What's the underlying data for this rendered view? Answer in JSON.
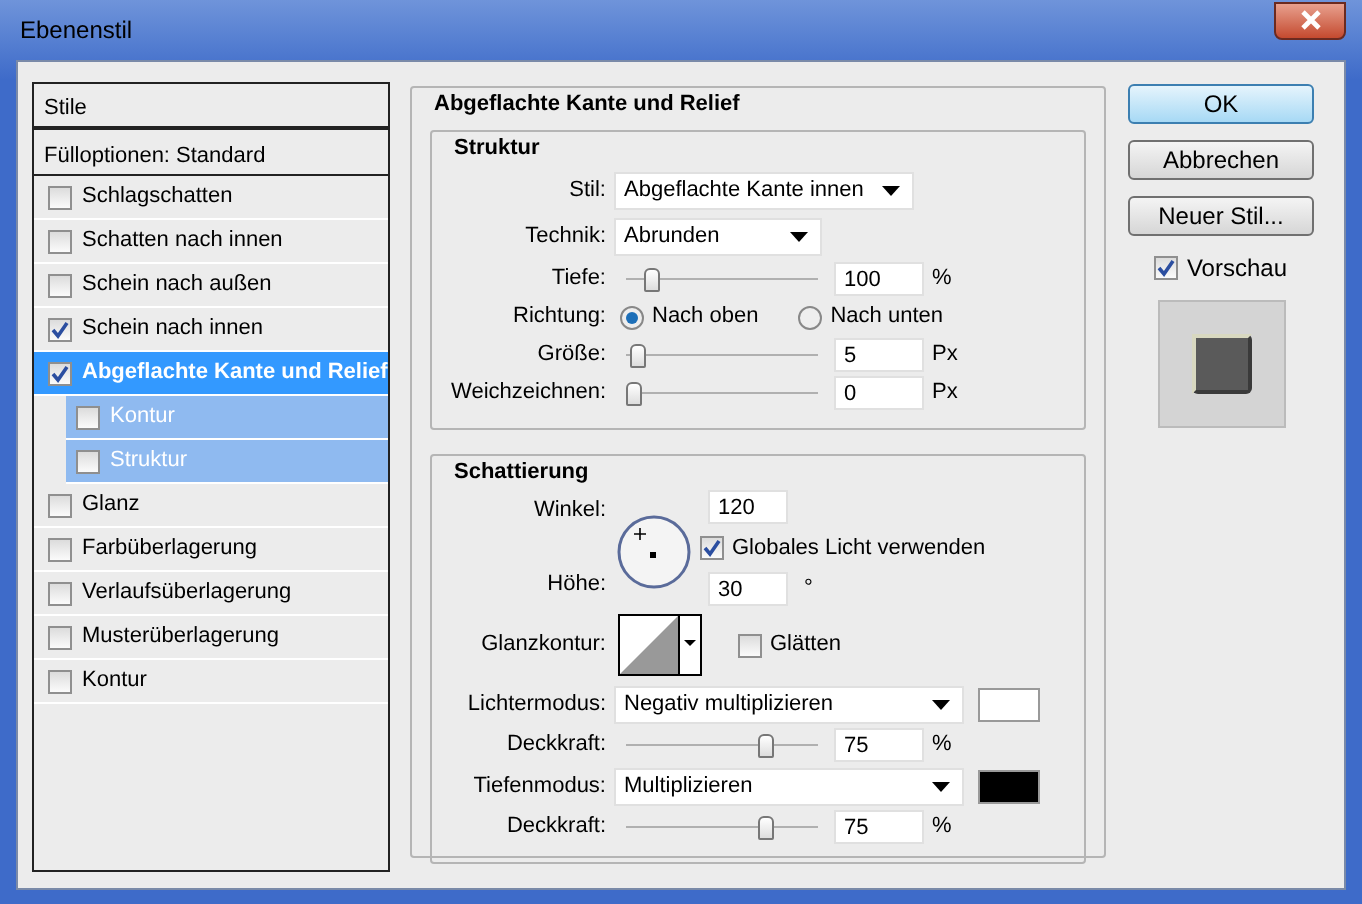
{
  "window": {
    "title": "Ebenenstil"
  },
  "styles_panel": {
    "header": "Stile",
    "blending_options": "Fülloptionen: Standard",
    "items": [
      {
        "label": "Schlagschatten",
        "checked": false,
        "selected": false
      },
      {
        "label": "Schatten nach innen",
        "checked": false,
        "selected": false
      },
      {
        "label": "Schein nach außen",
        "checked": false,
        "selected": false
      },
      {
        "label": "Schein nach innen",
        "checked": true,
        "selected": false
      },
      {
        "label": "Abgeflachte Kante und Relief",
        "checked": true,
        "selected": true,
        "children": [
          {
            "label": "Kontur",
            "checked": false,
            "selected": false
          },
          {
            "label": "Struktur",
            "checked": false,
            "selected": false
          }
        ]
      },
      {
        "label": "Glanz",
        "checked": false,
        "selected": false
      },
      {
        "label": "Farbüberlagerung",
        "checked": false,
        "selected": false
      },
      {
        "label": "Verlaufsüberlagerung",
        "checked": false,
        "selected": false
      },
      {
        "label": "Musterüberlagerung",
        "checked": false,
        "selected": false
      },
      {
        "label": "Kontur",
        "checked": false,
        "selected": false
      }
    ]
  },
  "bevel": {
    "title": "Abgeflachte Kante und Relief",
    "structure": {
      "title": "Struktur",
      "rows": [
        {
          "kind": "select",
          "label": "Stil:",
          "value": "Abgeflachte Kante innen"
        },
        {
          "kind": "select",
          "label": "Technik:",
          "value": "Abrunden"
        },
        {
          "kind": "slider",
          "label": "Tiefe:",
          "level": 0.1,
          "value": "100",
          "unit": "%"
        },
        {
          "kind": "radio",
          "label": "Richtung:",
          "options": [
            {
              "label": "Nach oben",
              "selected": true
            },
            {
              "label": "Nach unten",
              "selected": false
            }
          ]
        },
        {
          "kind": "slider",
          "label": "Größe:",
          "level": 0.02,
          "value": "5",
          "unit": "Px"
        },
        {
          "kind": "slider",
          "label": "Weichzeichnen:",
          "level": 0,
          "value": "0",
          "unit": "Px"
        }
      ]
    },
    "shading": {
      "title": "Schattierung",
      "angle": {
        "label": "Winkel:",
        "value": "120"
      },
      "global_light": {
        "label": "Globales Licht verwenden",
        "checked": true
      },
      "altitude": {
        "label": "Höhe:",
        "value": "30",
        "unit": "°"
      },
      "gloss_contour": {
        "label": "Glanzkontur:"
      },
      "anti_aliased": {
        "label": "Glätten",
        "checked": false
      },
      "rows": [
        {
          "kind": "mode",
          "label": "Lichtermodus:",
          "value": "Negativ multiplizieren",
          "color": "#ffffff"
        },
        {
          "kind": "slider",
          "label": "Deckkraft:",
          "level": 0.75,
          "value": "75",
          "unit": "%"
        },
        {
          "kind": "mode",
          "label": "Tiefenmodus:",
          "value": "Multiplizieren",
          "color": "#000000"
        },
        {
          "kind": "slider",
          "label": "Deckkraft:",
          "level": 0.75,
          "value": "75",
          "unit": "%"
        }
      ]
    }
  },
  "buttons": [
    {
      "label": "OK",
      "default": true
    },
    {
      "label": "Abbrechen",
      "default": false
    },
    {
      "label": "Neuer Stil...",
      "default": false
    }
  ],
  "preview": {
    "label": "Vorschau",
    "checked": true
  }
}
